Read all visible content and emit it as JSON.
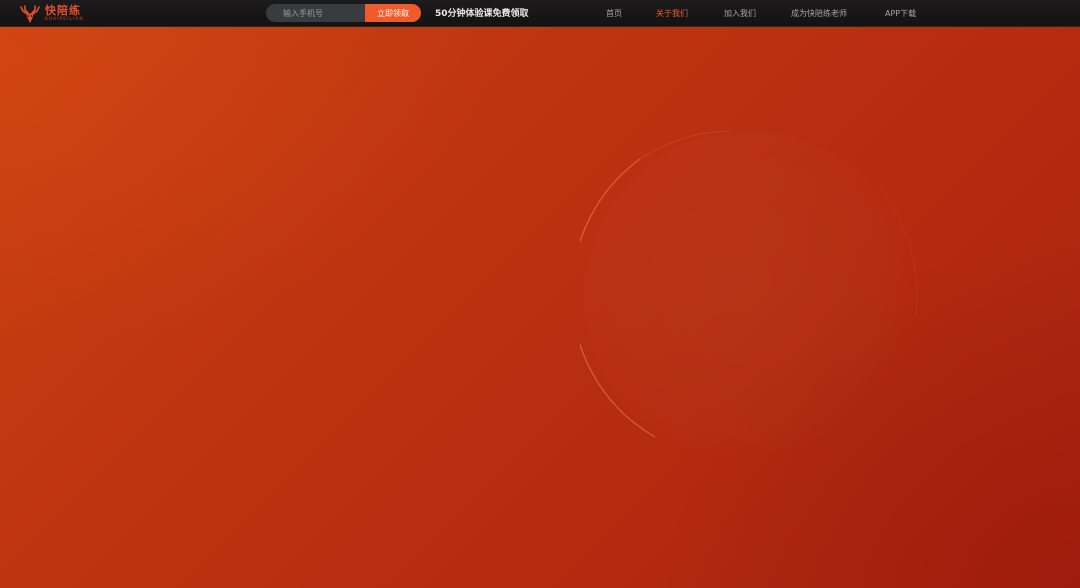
{
  "header": {
    "logo": {
      "name_cn": "快陪练",
      "name_en": "KUAIPEILIAN"
    },
    "signup": {
      "phone_placeholder": "输入手机号",
      "claim_label": "立即领取"
    },
    "promo_text": "50分钟体验课免费领取",
    "nav": [
      {
        "label": "首页",
        "active": false
      },
      {
        "label": "关于我们",
        "active": true
      },
      {
        "label": "加入我们",
        "active": false
      },
      {
        "label": "成为快陪练老师",
        "active": false
      },
      {
        "label": "APP下载",
        "active": false
      }
    ]
  },
  "colors": {
    "accent": "#f05a2b",
    "active_nav": "#f25a2c",
    "topbar_bg": "#1a1818",
    "hero_bg_start": "#c9420f",
    "hero_bg_end": "#a92210"
  },
  "icons": {
    "logo": "deer-antler-icon"
  }
}
